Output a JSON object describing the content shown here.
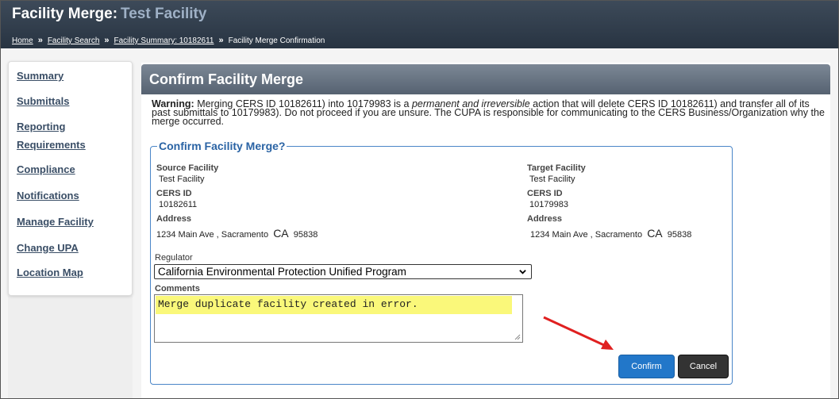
{
  "header": {
    "title": "Facility Merge:",
    "facility_name": "Test Facility"
  },
  "breadcrumb": {
    "items": [
      "Home",
      "Facility Search",
      "Facility Summary: 10182611"
    ],
    "separator": "»",
    "current": "Facility Merge Confirmation"
  },
  "sidebar": {
    "items": [
      {
        "label": "Summary"
      },
      {
        "label": "Submittals"
      },
      {
        "label": "Reporting"
      },
      {
        "label": "Requirements"
      },
      {
        "label": "Compliance"
      },
      {
        "label": "Notifications"
      },
      {
        "label": "Manage Facility"
      },
      {
        "label": "Change UPA"
      },
      {
        "label": "Location Map"
      }
    ]
  },
  "panel": {
    "title": "Confirm Facility Merge"
  },
  "warning": {
    "prefix": "Warning:",
    "text1": "Merging CERS ID 10182611) into 10179983 is a",
    "emphasis": "permanent and irreversible",
    "text2": "action that will delete CERS ID 10182611) and transfer all of its past submittals to 10179983). Do not proceed if you are unsure. The CUPA is responsible for communicating to the CERS Business/Organization why the merge occurred."
  },
  "form": {
    "legend": "Confirm Facility Merge?",
    "source": {
      "heading": "Source Facility",
      "name": "Test Facility",
      "cers_label": "CERS ID",
      "cers_id": "10182611",
      "address_label": "Address",
      "street": "1234 Main Ave",
      "city": "Sacramento",
      "state": "CA",
      "zip": "95838"
    },
    "target": {
      "heading": "Target Facility",
      "name": "Test Facility",
      "cers_label": "CERS ID",
      "cers_id": "10179983",
      "address_label": "Address",
      "street": "1234 Main Ave",
      "city": "Sacramento",
      "state": "CA",
      "zip": "95838"
    },
    "regulator_label": "Regulator",
    "regulator_value": "California Environmental Protection Unified Program",
    "comments_label": "Comments",
    "comments_value": "Merge duplicate facility created in error.",
    "confirm_label": "Confirm",
    "cancel_label": "Cancel"
  },
  "icons": {
    "select_arrow": "chevron-down-icon",
    "resize_grip": "resize-grip-icon",
    "annotation_arrow": "arrow-icon"
  },
  "colors": {
    "header_bg": "#2f3b4a",
    "facility_name": "#9fb1c6",
    "panel_head": "#6a7584",
    "legend": "#2a63a4",
    "confirm_bg": "#2277c9",
    "cancel_bg": "#333333",
    "highlight": "#faf87a",
    "annotation_arrow": "#e02020"
  }
}
